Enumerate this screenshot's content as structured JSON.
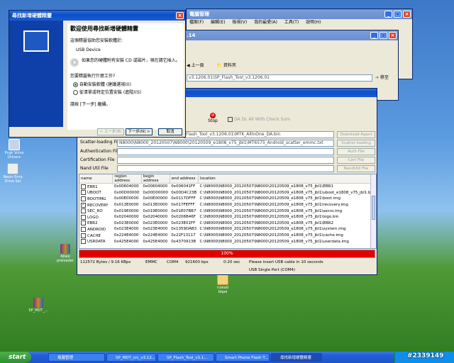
{
  "desktop": {
    "icons": [
      {
        "label": "Pcgk Vulns\nDrivers"
      },
      {
        "label": "Nwon Enra\nDrive Sst"
      },
      {
        "label": "Aliwo\npreloader"
      },
      {
        "label": "SP_MDT_..."
      },
      {
        "label": "rulead\nbtpol"
      }
    ],
    "watermark": "#2339149"
  },
  "explorer": {
    "title": "電腦管理",
    "menu": [
      "檔案(F)",
      "編輯(E)",
      "檢視(V)",
      "我的最愛(A)",
      "工具(T)",
      "說明(H)"
    ]
  },
  "explorer2": {
    "title": ".14",
    "address_value": "v3.1206.01\\SP_Flash_Tool_v3.1206.01",
    "go_label": "移至",
    "folders_label": "資料夾",
    "back_label": "上一頁"
  },
  "wizard": {
    "title": "尋找新增硬體精靈",
    "heading": "歡迎使用尋找新增硬體精靈",
    "intro": "這個精靈協助您安裝軟體於:",
    "device": "USB Device",
    "cd_text": "如果您的硬體附有安裝 CD 或磁片，現在請它插入。",
    "question": "您要精靈執行什麼工作?",
    "option_auto": "自動安裝軟體 (建議選項)(I)",
    "option_manual": "從清單或特定位置安裝 (進階)(S)",
    "continue_text": "請按 [下一步] 繼續。",
    "back_button": "< 上一步(B)",
    "next_button": "下一步(N) >",
    "cancel_button": "取消"
  },
  "flashtool": {
    "stop_label": "Stop",
    "da_dl_label": "DA DL All With Check Sum",
    "rows": [
      {
        "label": "",
        "value": "Flash_Tool_v3.1206.01\\MTK_AllInOne_DA.bin",
        "button": "Download Agent"
      },
      {
        "label": "Scatter-loading File",
        "value": "N8000\\N8000_20120507\\N8000\\20120509_e1808_v75_jbl1\\MT6575_Android_scatter_emmc.txt",
        "button": "Scatter-loading"
      },
      {
        "label": "Authentication File",
        "value": "",
        "button": "Auth File"
      },
      {
        "label": "Certification File",
        "value": "",
        "button": "Cert File"
      },
      {
        "label": "Nand Util File",
        "value": "",
        "button": "NandUtil File"
      }
    ],
    "columns": [
      "name",
      "region address",
      "begin address",
      "end address",
      "location"
    ],
    "partitions": [
      {
        "name": "EBR1",
        "checked": false,
        "region": "0x00604000",
        "begin": "0x00604000",
        "end": "0x006041FF",
        "location": "C:\\N8000\\N8000_20120507\\N8000\\20120509_e1808_v75_jbl1\\EBR1"
      },
      {
        "name": "UBOOT",
        "checked": false,
        "region": "0x00D00000",
        "begin": "0x00D00000",
        "end": "0x00D4C23B",
        "location": "C:\\N8000\\N8000_20120507\\N8000\\20120509_e1808_v75_jbl1\\uboot_e1808_v75_jbl1.bin"
      },
      {
        "name": "BOOTIMG",
        "checked": false,
        "region": "0x00E00000",
        "begin": "0x00E00000",
        "end": "0x0117DFFF",
        "location": "C:\\N8000\\N8000_20120507\\N8000\\20120509_e1808_v75_jbl1\\boot.img"
      },
      {
        "name": "RECOVERY",
        "checked": true,
        "region": "0x013E0000",
        "begin": "0x013E0000",
        "end": "0x017FEFFF",
        "location": "C:\\N8000\\N8000_20120507\\N8000\\20120509_e1808_v75_jbl1\\recovery.img"
      },
      {
        "name": "SEC_RO",
        "checked": false,
        "region": "0x019E0000",
        "begin": "0x019E0000",
        "end": "0x01E07BB7",
        "location": "C:\\N8000\\N8000_20120507\\N8000\\20120509_e1808_v75_jbl1\\secro.img"
      },
      {
        "name": "LOGO",
        "checked": false,
        "region": "0x02040000",
        "begin": "0x02040000",
        "end": "0x0206B46F",
        "location": "C:\\N8000\\N8000_20120507\\N8000\\20120509_e1808_v75_jbl1\\logo.bin"
      },
      {
        "name": "EBR2",
        "checked": false,
        "region": "0x023E0000",
        "begin": "0x023E0000",
        "end": "0x023E01FF",
        "location": "C:\\N8000\\N8000_20120507\\N8000\\20120509_e1808_v75_jbl1\\EBR2"
      },
      {
        "name": "ANDROID",
        "checked": false,
        "region": "0x023E4000",
        "begin": "0x023E4000",
        "end": "0x1359DAB3",
        "location": "C:\\N8000\\N8000_20120507\\N8000\\20120509_e1808_v75_jbl1\\system.img"
      },
      {
        "name": "CACHE",
        "checked": false,
        "region": "0x224E4000",
        "begin": "0x224E4000",
        "end": "0x22F13117",
        "location": "C:\\N8000\\N8000_20120507\\N8000\\20120509_e1808_v75_jbl1\\cache.img"
      },
      {
        "name": "USRDATA",
        "checked": false,
        "region": "0x425E4000",
        "begin": "0x425E4000",
        "end": "0x4370913B",
        "location": "C:\\N8000\\N8000_20120507\\N8000\\20120509_e1808_v75_jbl1\\userdata.img"
      }
    ],
    "progress_text": "100%",
    "progress_fraction": 1.0,
    "progress_color": "#e00000",
    "status": {
      "bytes": "112572 Bytes / 9.16 KBps",
      "storage": "EMMC",
      "port": "COM4",
      "baud": "921600 bps",
      "time": "0:20 sec",
      "message": "Please insert USB cable in 10 seconds",
      "usb_port": "USB Single Port (COM4)"
    }
  },
  "taskbar": {
    "start_label": "start",
    "tasks": [
      "電腦管理",
      "SP_MDT_src_v3.12...",
      "SP_Flash_Tool_v3.1...",
      "Smart Phone Flash T...",
      "尋找新增硬體精靈"
    ],
    "active_index": 4
  },
  "colors": {
    "titlebar": "#0a4fc9",
    "window_bg": "#ece9d8",
    "progress": "#e00000"
  }
}
